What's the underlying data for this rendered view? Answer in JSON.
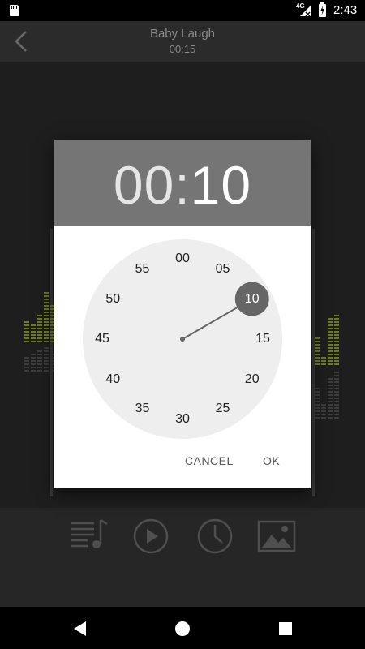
{
  "status_bar": {
    "network": "4G",
    "time": "2:43"
  },
  "app_bar": {
    "title": "Baby Laugh",
    "subtitle": "00:15"
  },
  "controls": [
    "playlist-icon",
    "play-icon",
    "clock-icon",
    "image-icon"
  ],
  "dialog": {
    "hours": "00",
    "separator": ":",
    "minutes": "10",
    "selected_minute": "10",
    "clock_numbers": [
      "00",
      "05",
      "10",
      "15",
      "20",
      "25",
      "30",
      "35",
      "40",
      "45",
      "50",
      "55"
    ],
    "cancel_label": "CANCEL",
    "ok_label": "OK"
  },
  "colors": {
    "dialog_header": "#757575",
    "clock_face": "#eeeeee",
    "selection": "#666666",
    "eq_bars": "#6d7d1c"
  }
}
